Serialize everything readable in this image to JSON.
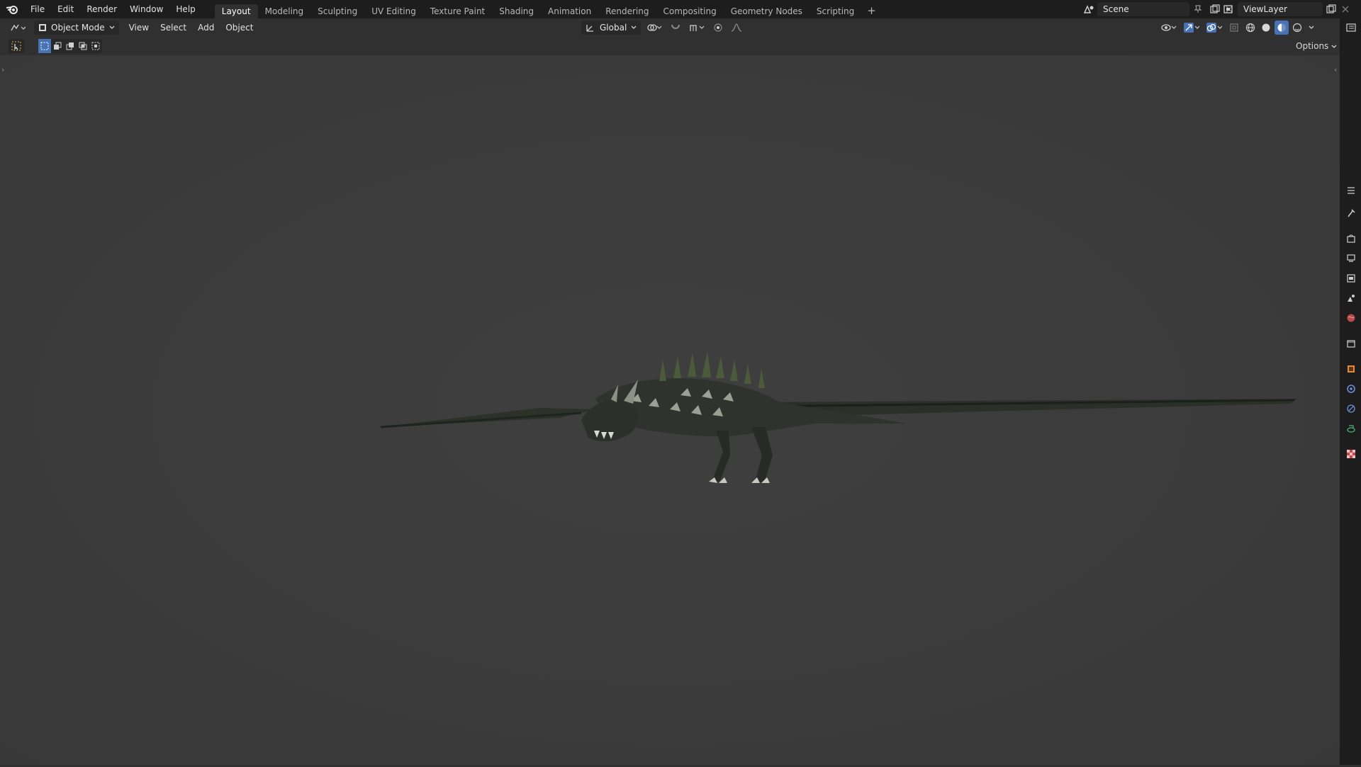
{
  "menu": [
    "File",
    "Edit",
    "Render",
    "Window",
    "Help"
  ],
  "workspaces": [
    "Layout",
    "Modeling",
    "Sculpting",
    "UV Editing",
    "Texture Paint",
    "Shading",
    "Animation",
    "Rendering",
    "Compositing",
    "Geometry Nodes",
    "Scripting"
  ],
  "workspace_add": "+",
  "scene": {
    "name": "Scene"
  },
  "view_layer": {
    "name": "ViewLayer"
  },
  "header": {
    "mode": "Object Mode",
    "view_menu": [
      "View",
      "Select",
      "Add",
      "Object"
    ],
    "transform_orientation": "Global"
  },
  "toolbar": {
    "options_label": "Options"
  },
  "colors": {
    "accent": "#4772b3",
    "topbar": "#1d1d1d",
    "viewport": "#3d3d3d"
  },
  "icons": [
    "blender-logo-icon",
    "select-box-icon",
    "scene-icon",
    "view-layer-icon",
    "pin-icon",
    "close-icon",
    "overlays-icon",
    "shading-solid-icon",
    "properties-tool-icon",
    "render-icon",
    "output-icon",
    "view-layer-props-icon",
    "scene-props-icon",
    "world-icon",
    "collection-icon",
    "object-icon",
    "modifier-icon",
    "particles-icon",
    "physics-icon",
    "texture-icon"
  ]
}
